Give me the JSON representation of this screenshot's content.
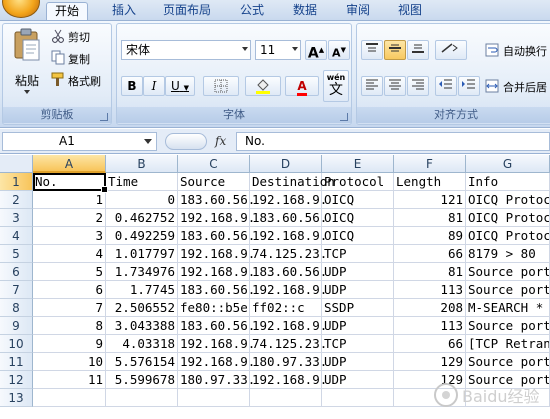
{
  "tabs": [
    "开始",
    "插入",
    "页面布局",
    "公式",
    "数据",
    "审阅",
    "视图"
  ],
  "clipboard": {
    "paste": "粘贴",
    "cut": "剪切",
    "copy": "复制",
    "format_painter": "格式刷",
    "label": "剪贴板"
  },
  "font": {
    "name": "宋体",
    "size": "11",
    "grow": "A",
    "shrink": "A",
    "bold": "B",
    "italic": "I",
    "underline": "U",
    "phonetic_top": "wén",
    "phonetic_char": "文",
    "label": "字体"
  },
  "alignment": {
    "wrap": "自动换行",
    "merge": "合并后居",
    "label": "对齐方式"
  },
  "formula_bar": {
    "name_box": "A1",
    "fx": "fx",
    "content": "No."
  },
  "columns": [
    "A",
    "B",
    "C",
    "D",
    "E",
    "F",
    "G"
  ],
  "rows": [
    [
      "No.",
      "Time",
      "Source",
      "Destination",
      "Protocol",
      "Length",
      "Info"
    ],
    [
      "1",
      "0",
      "183.60.56.",
      "192.168.9.",
      "OICQ",
      "121",
      "OICQ Protocol"
    ],
    [
      "2",
      "0.462752",
      "192.168.9.",
      "183.60.56.",
      "OICQ",
      "81",
      "OICQ Protocol"
    ],
    [
      "3",
      "0.492259",
      "183.60.56.",
      "192.168.9.",
      "OICQ",
      "89",
      "OICQ Protocol"
    ],
    [
      "4",
      "1.017797",
      "192.168.9.",
      "74.125.23.",
      "TCP",
      "66",
      "8179 > 80"
    ],
    [
      "5",
      "1.734976",
      "192.168.9.",
      "183.60.56.",
      "UDP",
      "81",
      "Source port"
    ],
    [
      "6",
      "1.7745",
      "183.60.56.",
      "192.168.9.",
      "UDP",
      "113",
      "Source port"
    ],
    [
      "7",
      "2.506552",
      "fe80::b5e",
      "ff02::c",
      "SSDP",
      "208",
      "M-SEARCH * "
    ],
    [
      "8",
      "3.043388",
      "183.60.56.",
      "192.168.9.",
      "UDP",
      "113",
      "Source port"
    ],
    [
      "9",
      "4.03318",
      "192.168.9.",
      "74.125.23.",
      "TCP",
      "66",
      "[TCP Retrans"
    ],
    [
      "10",
      "5.576154",
      "192.168.9.",
      "180.97.33.",
      "UDP",
      "129",
      "Source port"
    ],
    [
      "11",
      "5.599678",
      "180.97.33.",
      "192.168.9.",
      "UDP",
      "129",
      "Source port"
    ],
    [
      "",
      "",
      "",
      "",
      "",
      "",
      ""
    ]
  ],
  "row_numbers": [
    "1",
    "2",
    "3",
    "4",
    "5",
    "6",
    "7",
    "8",
    "9",
    "10",
    "11",
    "12",
    "13"
  ],
  "watermark_text": "Baidu经验"
}
